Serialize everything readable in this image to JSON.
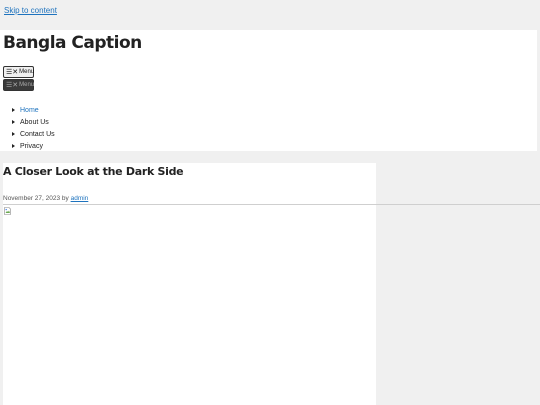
{
  "skip_link": "Skip to content",
  "site": {
    "title": "Bangla Caption"
  },
  "menu_toggles": [
    {
      "label": "Menu",
      "icon": "hamburger-close-icon",
      "variant": "light"
    },
    {
      "label": "Menu",
      "icon": "hamburger-close-icon",
      "variant": "dark"
    }
  ],
  "nav": {
    "items": [
      {
        "label": "Home",
        "active": true
      },
      {
        "label": "About Us",
        "active": false
      },
      {
        "label": "Contact Us",
        "active": false
      },
      {
        "label": "Privacy",
        "active": false
      }
    ]
  },
  "post": {
    "title": "A Closer Look at the Dark Side",
    "date": "November 27, 2023",
    "by": "by",
    "author": "admin",
    "image_icon": "broken-image-icon"
  },
  "colors": {
    "link": "#1e73be",
    "background": "#f0f0f0",
    "surface": "#ffffff",
    "text": "#222222"
  }
}
